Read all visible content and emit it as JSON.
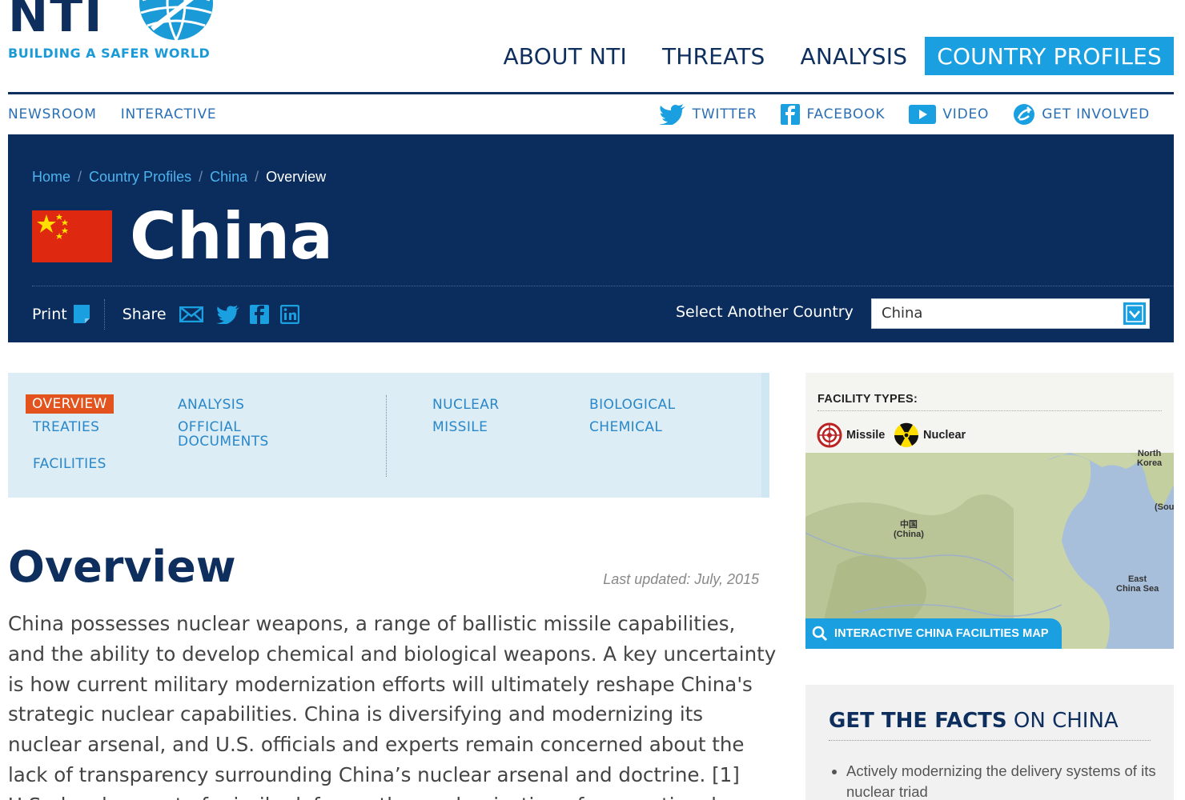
{
  "brand": {
    "logo_letters": "NTI",
    "tagline": "BUILDING A SAFER WORLD"
  },
  "main_nav": [
    "ABOUT NTI",
    "THREATS",
    "ANALYSIS",
    "COUNTRY PROFILES"
  ],
  "main_nav_active": "COUNTRY PROFILES",
  "sub_nav": [
    "NEWSROOM",
    "INTERACTIVE"
  ],
  "social_nav": [
    {
      "label": "TWITTER",
      "icon": "twitter-icon"
    },
    {
      "label": "FACEBOOK",
      "icon": "facebook-icon"
    },
    {
      "label": "VIDEO",
      "icon": "video-play-icon"
    },
    {
      "label": "GET INVOLVED",
      "icon": "get-involved-icon"
    }
  ],
  "breadcrumb": [
    "Home",
    "Country Profiles",
    "China",
    "Overview"
  ],
  "country": {
    "name": "China",
    "flag_icon": "china-flag"
  },
  "tools": {
    "print_label": "Print",
    "share_label": "Share",
    "share_icons": [
      "email-icon",
      "twitter-icon",
      "facebook-icon",
      "linkedin-icon"
    ],
    "select_label": "Select Another Country",
    "select_value": "China"
  },
  "tabs": {
    "left_col1": [
      "OVERVIEW",
      "TREATIES",
      "FACILITIES"
    ],
    "left_col2": [
      "ANALYSIS",
      "OFFICIAL DOCUMENTS"
    ],
    "right_col1": [
      "NUCLEAR",
      "MISSILE"
    ],
    "right_col2": [
      "BIOLOGICAL",
      "CHEMICAL"
    ],
    "active": "OVERVIEW"
  },
  "overview": {
    "title": "Overview",
    "last_updated": "Last updated: July, 2015",
    "body": "China possesses nuclear weapons, a range of ballistic missile capabilities, and the ability to develop chemical and biological weapons. A key uncertainty is how current military modernization efforts will ultimately reshape China's strategic nuclear capabilities. China is diversifying and modernizing its nuclear arsenal, and U.S. officials and experts remain concerned about the lack of transparency surrounding China’s nuclear arsenal and doctrine. [1] U.S. development of missile defense, the modernization of conventional"
  },
  "map": {
    "legend_title": "FACILITY TYPES:",
    "legend_items": [
      {
        "label": "Missile",
        "icon": "missile-target-icon"
      },
      {
        "label": "Nuclear",
        "icon": "radiation-icon"
      }
    ],
    "labels": {
      "china_native": "中国",
      "china": "(China)",
      "north_korea_1": "North",
      "north_korea_2": "Korea",
      "south_korea": "(Sou",
      "east_china_sea_1": "East",
      "east_china_sea_2": "China Sea"
    },
    "button_label": "INTERACTIVE CHINA FACILITIES MAP",
    "colors": {
      "land": "#c9d4a9",
      "sea": "#a7bfdb",
      "button": "#1aa0e0"
    }
  },
  "facts": {
    "title_bold": "GET THE FACTS",
    "title_rest": " ON CHINA",
    "items": [
      "Actively modernizing the delivery systems of its nuclear triad"
    ]
  },
  "colors": {
    "navy": "#0b2d5e",
    "accent_blue": "#1aa0e0",
    "link_blue": "#2a87c8",
    "active_tab": "#e3531e",
    "flag_red": "#de2910",
    "flag_yellow": "#ffde00"
  }
}
